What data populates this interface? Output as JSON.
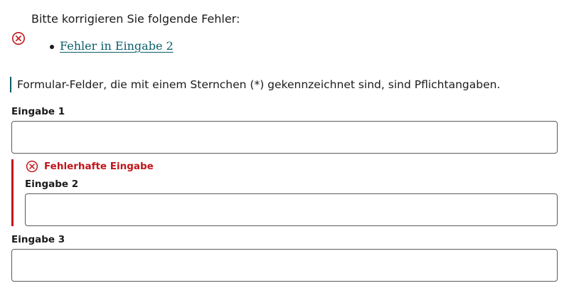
{
  "error_summary": {
    "title": "Bitte korrigieren Sie folgende Fehler:",
    "icon": "error-circle-x-icon",
    "items": [
      {
        "label": "Fehler in Eingabe 2"
      }
    ]
  },
  "hint": "Formular-Felder, die mit einem Sternchen (*) gekennzeichnet sind, sind Pflichtangaben.",
  "fields": [
    {
      "label": "Eingabe 1",
      "value": "",
      "has_error": false
    },
    {
      "label": "Eingabe 2",
      "value": "",
      "has_error": true,
      "error_message": "Fehlerhafte Eingabe"
    },
    {
      "label": "Eingabe 3",
      "value": "",
      "has_error": false
    }
  ],
  "colors": {
    "error": "#c0161b",
    "link": "#0b5d6b",
    "text": "#1b1b1b",
    "border": "#5a5a5a"
  }
}
